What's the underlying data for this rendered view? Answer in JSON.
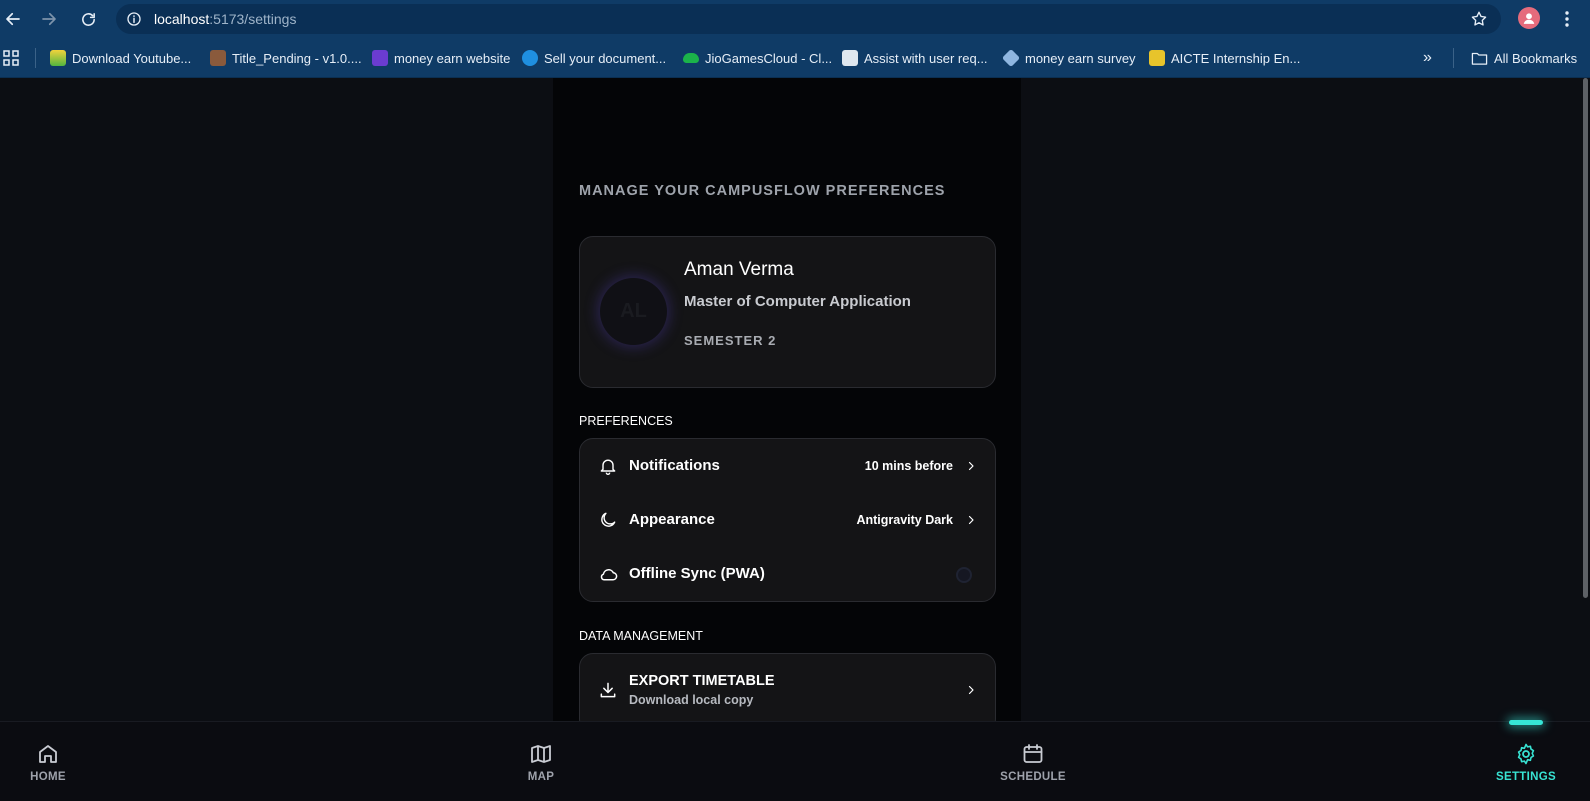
{
  "browser": {
    "url_host": "localhost",
    "url_path": ":5173/settings",
    "bookmarks": [
      {
        "label": "Download Youtube..."
      },
      {
        "label": "Title_Pending - v1.0...."
      },
      {
        "label": "money earn website"
      },
      {
        "label": "Sell your document..."
      },
      {
        "label": "JioGamesCloud - Cl..."
      },
      {
        "label": "Assist with user req..."
      },
      {
        "label": "money earn survey"
      },
      {
        "label": "AICTE Internship En..."
      }
    ],
    "more": "»",
    "all_bookmarks": "All Bookmarks"
  },
  "page": {
    "subtitle": "MANAGE YOUR CAMPUSFLOW PREFERENCES"
  },
  "profile": {
    "initials": "AL",
    "name": "Aman Verma",
    "degree": "Master of Computer Application",
    "semester": "SEMESTER 2"
  },
  "preferences": {
    "heading": "PREFERENCES",
    "notifications": {
      "label": "Notifications",
      "value": "10 mins before"
    },
    "appearance": {
      "label": "Appearance",
      "value": "Antigravity Dark"
    },
    "offline_sync": {
      "label": "Offline Sync (PWA)",
      "enabled": false
    }
  },
  "data_management": {
    "heading": "DATA MANAGEMENT",
    "export": {
      "label": "EXPORT TIMETABLE",
      "sub": "Download local copy"
    }
  },
  "bottom_nav": {
    "home": "HOME",
    "map": "MAP",
    "schedule": "SCHEDULE",
    "settings": "SETTINGS",
    "active": "settings",
    "accent": "#38e3d3"
  }
}
